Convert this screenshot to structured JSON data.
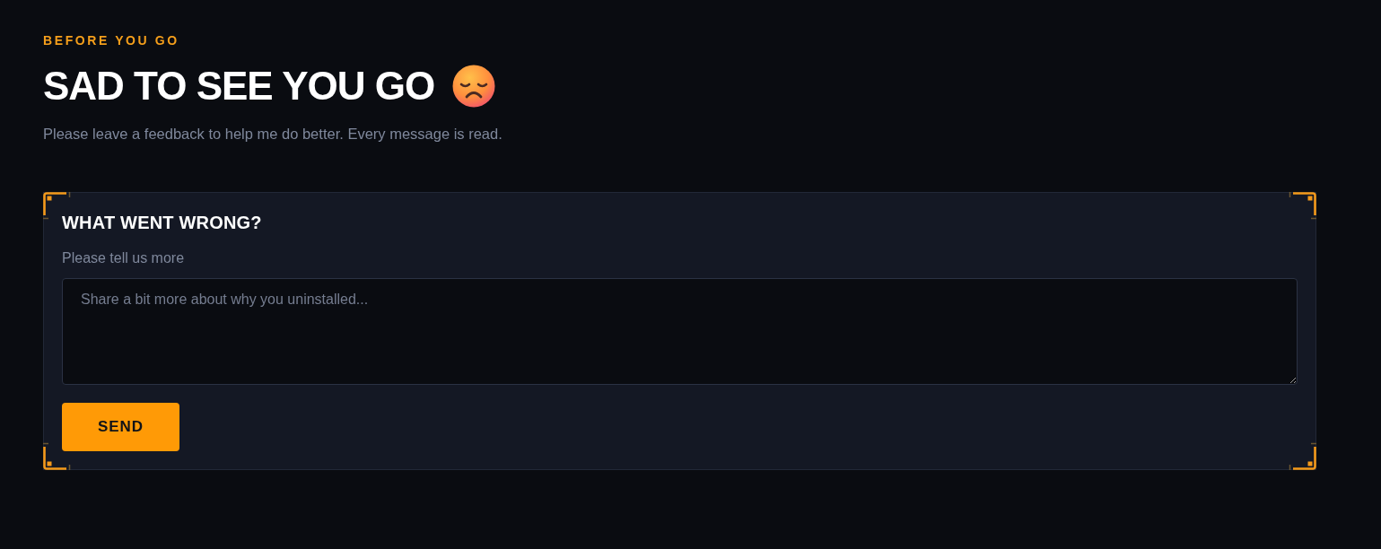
{
  "eyebrow": "BEFORE YOU GO",
  "title": "SAD TO SEE YOU GO",
  "subtitle": "Please leave a feedback to help me do better. Every message is read.",
  "form": {
    "heading": "WHAT WENT WRONG?",
    "label": "Please tell us more",
    "message": {
      "placeholder": "Share a bit more about why you uninstalled..."
    },
    "submit": "SEND"
  }
}
